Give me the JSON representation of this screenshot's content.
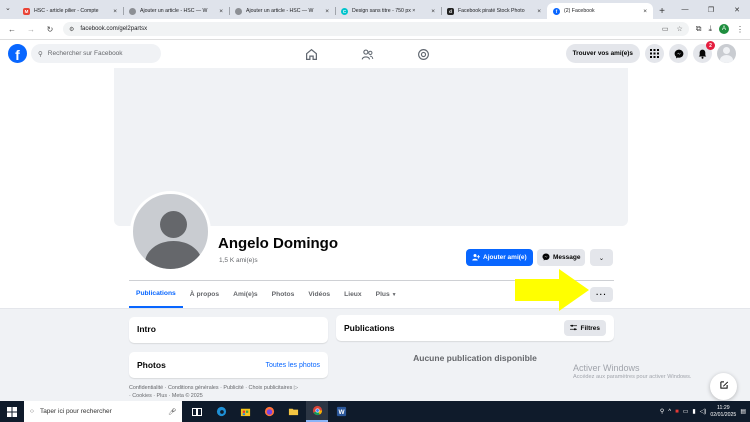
{
  "browser": {
    "tabs": [
      {
        "title": "HSC - article pilier - Compte",
        "favicon": "gmail-icon",
        "color": "#ea4335",
        "glyph": "M",
        "active": false
      },
      {
        "title": "Ajouter un article - HSC — W",
        "favicon": "wordpress-icon",
        "color": "#8c8f94",
        "glyph": "",
        "active": false
      },
      {
        "title": "Ajouter un article - HSC — W",
        "favicon": "wordpress-icon",
        "color": "#8c8f94",
        "glyph": "",
        "active": false
      },
      {
        "title": "Design sans titre - 750 px ×",
        "favicon": "canva-icon",
        "color": "#00c4cc",
        "glyph": "C",
        "active": false
      },
      {
        "title": "Facebook piraté Stock Photo",
        "favicon": "stock-icon",
        "color": "#222222",
        "glyph": "d",
        "active": false
      },
      {
        "title": "(2) Facebook",
        "favicon": "facebook-icon",
        "color": "#0866ff",
        "glyph": "f",
        "active": true
      }
    ],
    "url": "facebook.com/gel2partsx",
    "profile_initial": "A"
  },
  "fb_header": {
    "search_placeholder": "Rechercher sur Facebook",
    "find_friends": "Trouver vos ami(e)s",
    "notification_count": "2"
  },
  "profile": {
    "name": "Angelo Domingo",
    "friends": "1,5 K ami(e)s",
    "add_friend": "Ajouter ami(e)",
    "message": "Message",
    "tabs": [
      "Publications",
      "À propos",
      "Ami(e)s",
      "Photos",
      "Vidéos",
      "Lieux",
      "Plus"
    ],
    "more_label": "···"
  },
  "intro": {
    "title": "Intro"
  },
  "photos": {
    "title": "Photos",
    "link": "Toutes les photos"
  },
  "publications": {
    "title": "Publications",
    "filters": "Filtres",
    "empty": "Aucune publication disponible"
  },
  "footer": {
    "line1": "Confidentialité · Conditions générales · Publicité · Choix publicitaires",
    "line2": "· Cookies · Plus · Meta © 2025"
  },
  "watermark": {
    "line1": "Activer Windows",
    "line2": "Accédez aux paramètres pour activer Windows."
  },
  "taskbar": {
    "search_placeholder": "Taper ici pour rechercher",
    "time": "11:29",
    "date": "02/01/2025"
  },
  "colors": {
    "fb_blue": "#0866ff",
    "arrow": "#ffff00",
    "taskbar": "#0f1b2b"
  }
}
